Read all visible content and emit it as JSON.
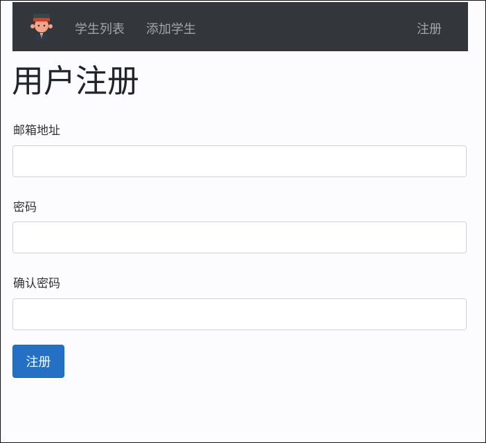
{
  "nav": {
    "logo_icon": "student-avatar-icon",
    "links": [
      "学生列表",
      "添加学生"
    ],
    "register_link": "注册"
  },
  "page_title": "用户注册",
  "form": {
    "email_label": "邮箱地址",
    "email_value": "",
    "password_label": "密码",
    "password_value": "",
    "confirm_label": "确认密码",
    "confirm_value": "",
    "submit_label": "注册"
  },
  "colors": {
    "navbar": "#33373b",
    "primary": "#2370c4"
  }
}
